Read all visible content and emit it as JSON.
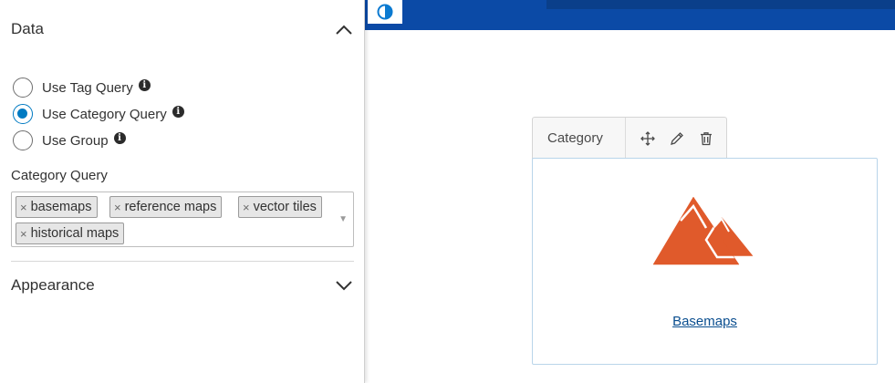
{
  "panel": {
    "data_section": {
      "title": "Data"
    },
    "query_options": [
      {
        "label": "Use Tag Query",
        "checked": false
      },
      {
        "label": "Use Category Query",
        "checked": true
      },
      {
        "label": "Use Group",
        "checked": false
      }
    ],
    "category_query": {
      "label": "Category Query",
      "tags": [
        "basemaps",
        "reference maps",
        "vector tiles",
        "historical maps"
      ]
    },
    "appearance_section": {
      "title": "Appearance"
    }
  },
  "widget": {
    "toolbar_label": "Category",
    "category_name": "Basemaps",
    "icons": [
      "move-icon",
      "pencil-icon",
      "trash-icon"
    ]
  },
  "colors": {
    "accent": "#007ac2",
    "banner": "#0b4aa6",
    "mountain": "#e05a2b",
    "link": "#0a4e8f"
  }
}
